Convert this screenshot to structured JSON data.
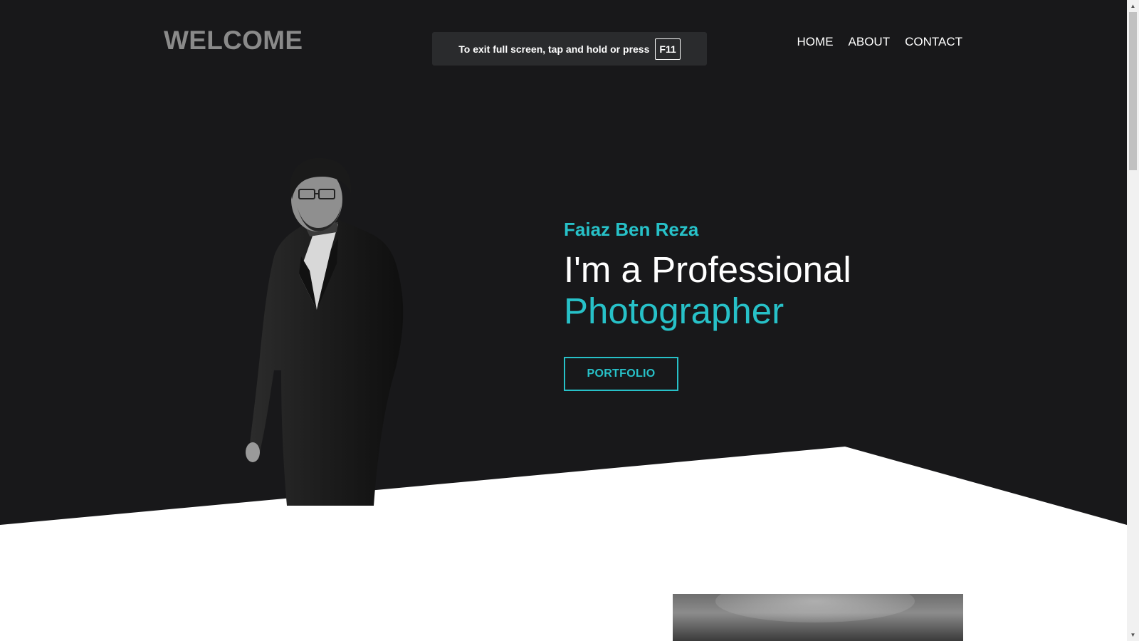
{
  "header": {
    "brand": "WELCOME",
    "nav": [
      {
        "label": "HOME"
      },
      {
        "label": "ABOUT"
      },
      {
        "label": "CONTACT"
      }
    ]
  },
  "fullscreen_notice": {
    "text": "To exit full screen, tap and hold or press",
    "key": "F11"
  },
  "hero": {
    "name": "Faiaz Ben Reza",
    "line1": "I'm a Professional",
    "line2": "Photographer",
    "button_label": "PORTFOLIO"
  },
  "colors": {
    "background_dark": "#18181a",
    "accent": "#27c1c8",
    "brand_text": "#8a8a8a",
    "section_light": "#ffffff"
  },
  "icons": {
    "scroll_up": "scroll-up-arrow-icon",
    "scroll_down": "scroll-down-arrow-icon"
  }
}
